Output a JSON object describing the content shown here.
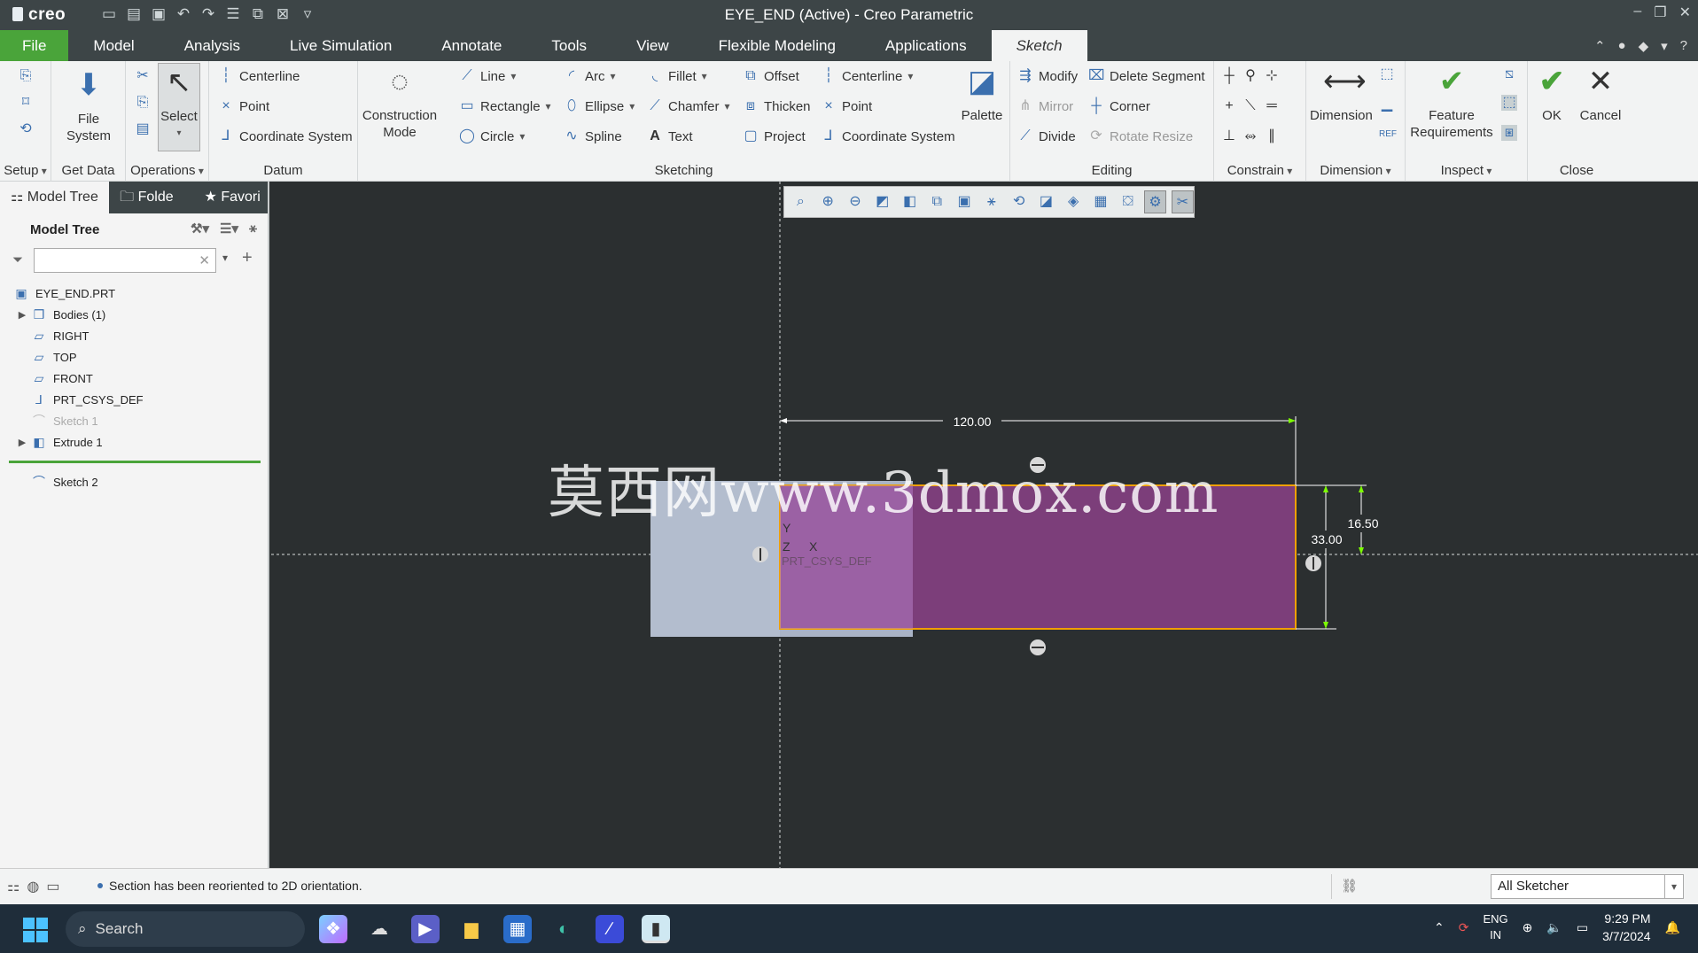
{
  "app": {
    "logo": "creo",
    "window_title": "EYE_END (Active) - Creo Parametric",
    "qat_icons": [
      "new-icon",
      "open-icon",
      "save-icon",
      "undo-icon",
      "redo-icon",
      "regenerate-icon",
      "windows-icon",
      "close-window-icon",
      "customize-icon"
    ]
  },
  "tabs": [
    "File",
    "Model",
    "Analysis",
    "Live Simulation",
    "Annotate",
    "Tools",
    "View",
    "Flexible Modeling",
    "Applications",
    "Sketch"
  ],
  "active_tab": "Sketch",
  "ribbon": {
    "setup": {
      "label": "Setup"
    },
    "get_data": {
      "label": "Get Data",
      "file_system": "File\nSystem"
    },
    "operations": {
      "label": "Operations",
      "select": "Select"
    },
    "datum": {
      "label": "Datum",
      "centerline": "Centerline",
      "point": "Point",
      "coordinate_system": "Coordinate System"
    },
    "construction_mode": "Construction\nMode",
    "sketching": {
      "label": "Sketching",
      "line": "Line",
      "rectangle": "Rectangle",
      "circle": "Circle",
      "arc": "Arc",
      "ellipse": "Ellipse",
      "spline": "Spline",
      "fillet": "Fillet",
      "chamfer": "Chamfer",
      "text": "Text",
      "offset": "Offset",
      "thicken": "Thicken",
      "project": "Project",
      "centerline": "Centerline",
      "point": "Point",
      "coordinate_system": "Coordinate System",
      "palette": "Palette"
    },
    "editing": {
      "label": "Editing",
      "modify": "Modify",
      "mirror": "Mirror",
      "divide": "Divide",
      "delete_segment": "Delete Segment",
      "corner": "Corner",
      "rotate_resize": "Rotate Resize"
    },
    "constrain": {
      "label": "Constrain"
    },
    "dimension": {
      "label": "Dimension",
      "dimension": "Dimension"
    },
    "inspect": {
      "label": "Inspect",
      "feature_requirements": "Feature\nRequirements"
    },
    "close": {
      "label": "Close",
      "ok": "OK",
      "cancel": "Cancel"
    }
  },
  "left_panel": {
    "tabs": [
      "Model Tree",
      "Folde",
      "Favori"
    ],
    "header": "Model Tree",
    "filter_placeholder": "",
    "items": [
      {
        "label": "EYE_END.PRT",
        "icon": "part-icon",
        "expander": ""
      },
      {
        "label": "Bodies (1)",
        "icon": "bodies-icon",
        "expander": "▶"
      },
      {
        "label": "RIGHT",
        "icon": "datum-plane-icon",
        "expander": ""
      },
      {
        "label": "TOP",
        "icon": "datum-plane-icon",
        "expander": ""
      },
      {
        "label": "FRONT",
        "icon": "datum-plane-icon",
        "expander": ""
      },
      {
        "label": "PRT_CSYS_DEF",
        "icon": "csys-icon",
        "expander": ""
      },
      {
        "label": "Sketch 1",
        "icon": "sketch-icon",
        "expander": ""
      },
      {
        "label": "Extrude 1",
        "icon": "extrude-icon",
        "expander": "▶"
      }
    ],
    "active_item": {
      "label": "Sketch 2",
      "icon": "sketch-icon"
    }
  },
  "sketch": {
    "dim_width": "120.00",
    "dim_height": "33.00",
    "dim_offset": "16.50",
    "axis_y": "Y",
    "axis_z": "Z",
    "axis_x": "X",
    "csys_label": "PRT_CSYS_DEF",
    "watermark": "莫西网www.3dmox.com"
  },
  "graphics_toolbar_icons": [
    "refit-icon",
    "zoom-in-icon",
    "zoom-out-icon",
    "repaint-icon",
    "display-style-icon",
    "saved-orientations-icon",
    "view-manager-icon",
    "datum-display-icon",
    "annotation-display-icon",
    "spin-center-icon",
    "sketch-view-icon",
    "model-display-icon",
    "csys-display-icon",
    "sketcher-display-icon",
    "constraint-display-icon"
  ],
  "status": {
    "message": "Section has been reoriented to 2D orientation.",
    "filter": "All Sketcher"
  },
  "taskbar": {
    "search": "Search",
    "lang_top": "ENG",
    "lang_bottom": "IN",
    "time": "9:29 PM",
    "date": "3/7/2024"
  },
  "colors": {
    "creo_green": "#4aa43a",
    "solid_body": "#aab4c6",
    "section_fill": "#7c3e7a",
    "section_outline": "#f0a000",
    "dimension_line": "#ffffff"
  }
}
